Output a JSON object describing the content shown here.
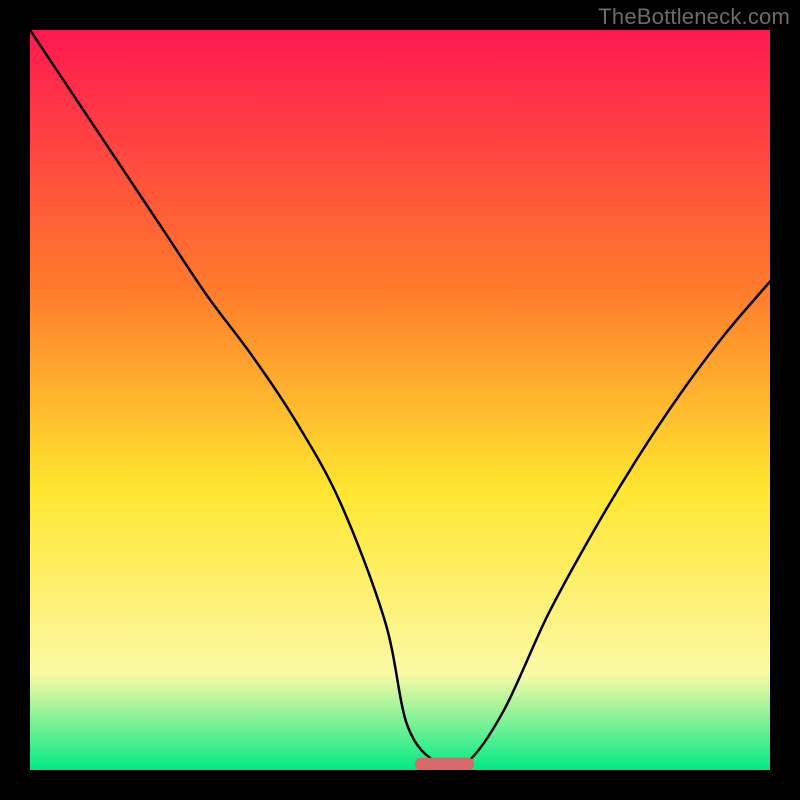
{
  "watermark": {
    "text": "TheBottleneck.com"
  },
  "chart_data": {
    "type": "line",
    "title": "",
    "xlabel": "",
    "ylabel": "",
    "xlim": [
      0,
      100
    ],
    "ylim": [
      0,
      100
    ],
    "grid": false,
    "legend": false,
    "series": [
      {
        "name": "bottleneck-curve",
        "x": [
          0,
          6,
          12,
          18,
          24,
          30,
          36,
          42,
          48,
          51,
          55,
          59,
          64,
          70,
          76,
          82,
          88,
          94,
          100
        ],
        "values": [
          100,
          91,
          82,
          73,
          64,
          56,
          47,
          36,
          20,
          6,
          1,
          1,
          8,
          21,
          32,
          42,
          51,
          59,
          66
        ]
      }
    ],
    "marker": {
      "name": "optimal-point",
      "x_start": 52,
      "x_end": 60,
      "y": 0.8,
      "color": "#d66a6a"
    },
    "background_gradient": {
      "top": "#ff1851",
      "mid_upper": "#ff7b2c",
      "mid": "#ffe62f",
      "lower": "#fbf9a6",
      "bottom": "#00ea86"
    }
  }
}
